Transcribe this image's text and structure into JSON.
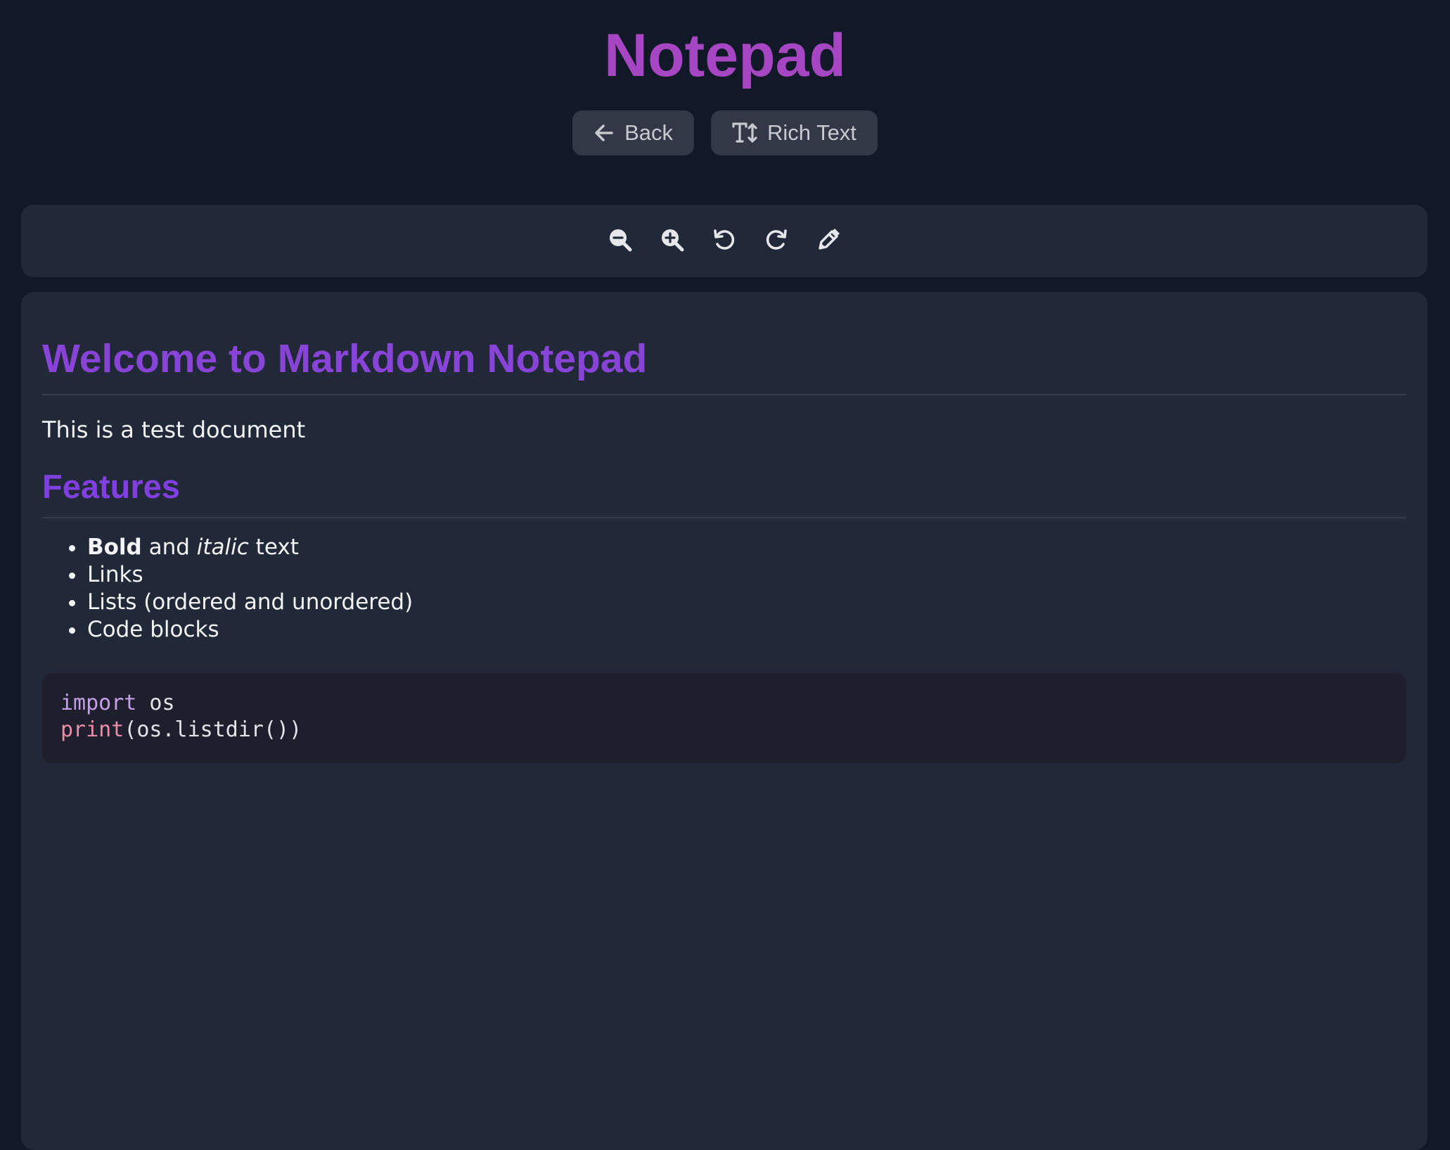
{
  "app": {
    "title": "Notepad"
  },
  "nav": {
    "back_label": "Back",
    "rich_text_label": "Rich Text"
  },
  "toolbar": {
    "icons": [
      "zoom-out-icon",
      "zoom-in-icon",
      "undo-icon",
      "redo-icon",
      "pencil-icon"
    ]
  },
  "document": {
    "heading1": "Welcome to Markdown Notepad",
    "paragraph": "This is a test document",
    "heading2": "Features",
    "features": {
      "item1": {
        "bold": "Bold",
        "and": " and ",
        "italic": "italic",
        "rest": " text"
      },
      "item2": "Links",
      "item3": "Lists (ordered and unordered)",
      "item4": "Code blocks"
    },
    "code": {
      "line1": {
        "keyword": "import",
        "rest": " os"
      },
      "line2": {
        "function": "print",
        "rest": "(os.listdir())"
      }
    }
  },
  "colors": {
    "background": "#111827",
    "panel": "#212837",
    "title": "#a646c2",
    "heading": "#8844d6",
    "button": "#323846",
    "code_background": "#1e1e2c"
  }
}
